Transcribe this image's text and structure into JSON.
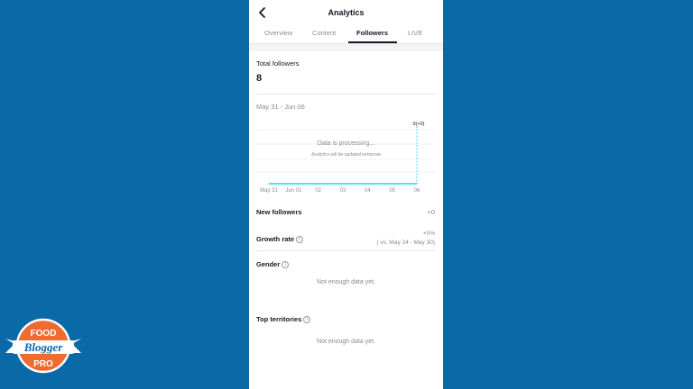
{
  "header": {
    "title": "Analytics",
    "back_icon": "chevron-left-icon"
  },
  "tabs": [
    {
      "label": "Overview",
      "active": false
    },
    {
      "label": "Content",
      "active": false
    },
    {
      "label": "Followers",
      "active": true
    },
    {
      "label": "LIVE",
      "active": false
    }
  ],
  "total_followers": {
    "label": "Total followers",
    "value": "8"
  },
  "date_range": "May 31 - Jun 06",
  "chart": {
    "processing_title": "Data is processing...",
    "processing_sub": "Analytics will be updated tomorrow",
    "last_value_label": "0(+0)"
  },
  "chart_data": {
    "type": "line",
    "x": [
      "May 31",
      "Jun 01",
      "02",
      "03",
      "04",
      "05",
      "06"
    ],
    "series": [
      {
        "values": [
          0,
          0,
          0,
          0,
          0,
          0,
          0
        ]
      }
    ],
    "color": "#20d5ec"
  },
  "new_followers": {
    "label": "New followers",
    "value": "+0"
  },
  "growth_rate": {
    "label": "Growth rate",
    "value": "+0%",
    "comparison": "( vs. May 24 - May 30)"
  },
  "gender": {
    "label": "Gender",
    "empty": "Not enough data yet."
  },
  "top_territories": {
    "label": "Top territories",
    "empty": "Not enough data yet."
  },
  "logo": {
    "line1": "FOOD",
    "line2": "Blogger",
    "line3": "PRO"
  }
}
